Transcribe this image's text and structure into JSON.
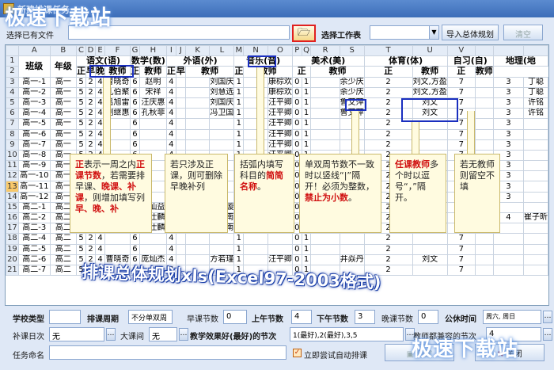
{
  "window": {
    "title": "新建排课任务"
  },
  "watermark": {
    "text": "极速下载站"
  },
  "top": {
    "task_name_label": "选择已有文件",
    "task_name_value": "",
    "workbook_label": "选择工作表",
    "workbook_value": "",
    "import_button": "导入总体规划",
    "clear_button": "清空"
  },
  "sheet": {
    "col_letters": [
      "A",
      "B",
      "C",
      "D",
      "E",
      "F",
      "G",
      "H",
      "I",
      "J",
      "K",
      "L",
      "M",
      "N",
      "O",
      "P",
      "Q",
      "R",
      "S",
      "T",
      "U",
      "V"
    ],
    "row1": [
      "班级",
      "年级",
      "语文(语)",
      "数学(数)",
      "外语(外)",
      "音乐(音)",
      "美术(美)",
      "体育(体)",
      "自习(自)",
      "地理(地"
    ],
    "row2": [
      "正",
      "早",
      "晚",
      "教师",
      "正",
      "教师",
      "正",
      "早",
      "教师",
      "正",
      "教师",
      "正",
      "教师",
      "正",
      "教师",
      "正",
      "教师"
    ],
    "rows": [
      {
        "n": "3",
        "cls": "高一-1",
        "grade": "高一",
        "a": "5",
        "b": "2",
        "c": "4",
        "t1": "曹晓奇",
        "m": "6",
        "t2": "赵明",
        "e": "4",
        "t3": "刘国庆",
        "mu": "1",
        "t4": "康棕欢",
        "ar": "0",
        "ar2": "1",
        "t5": "余少庆",
        "pe": "2",
        "t6": "刘文,方盈",
        "z": "7",
        "geo": "3",
        "t7": "丁聪"
      },
      {
        "n": "4",
        "cls": "高一-2",
        "grade": "高一",
        "a": "5",
        "b": "2",
        "c": "4",
        "t1": "孔伯聚",
        "m": "6",
        "t2": "宋祥",
        "e": "4",
        "t3": "刘慧选",
        "mu": "1",
        "t4": "康棕欢",
        "ar": "0",
        "ar2": "1",
        "t5": "余少庆",
        "pe": "2",
        "t6": "刘文,方盈",
        "z": "7",
        "geo": "3",
        "t7": "丁聪"
      },
      {
        "n": "5",
        "cls": "高一-3",
        "grade": "高一",
        "a": "5",
        "b": "2",
        "c": "4",
        "t1": "吕旭雷",
        "m": "6",
        "t2": "汪庆惠",
        "e": "4",
        "t3": "刘国庆",
        "mu": "1",
        "t4": "汪平卿",
        "ar": "0",
        "ar2": "1",
        "t5": "鲁艾萍",
        "pe": "2",
        "t6": "刘文",
        "z": "7",
        "geo": "3",
        "t7": "许铭"
      },
      {
        "n": "6",
        "cls": "高一-4",
        "grade": "高一",
        "a": "5",
        "b": "2",
        "c": "4",
        "t1": "刘继惠",
        "m": "6",
        "t2": "孔秋菲",
        "e": "4",
        "t3": "冯卫国",
        "mu": "1",
        "t4": "汪平卿",
        "ar": "0",
        "ar2": "1",
        "t5": "鲁艾萍",
        "pe": "2",
        "t6": "刘文",
        "z": "7",
        "geo": "3",
        "t7": "许铭"
      },
      {
        "n": "7",
        "cls": "高一-5",
        "grade": "高一",
        "a": "5",
        "b": "2",
        "c": "4",
        "t1": "",
        "m": "6",
        "t2": "",
        "e": "4",
        "t3": "",
        "mu": "1",
        "t4": "汪平卿",
        "ar": "0",
        "ar2": "1",
        "t5": "",
        "pe": "2",
        "t6": "",
        "z": "7",
        "geo": "3",
        "t7": ""
      },
      {
        "n": "8",
        "cls": "高一-6",
        "grade": "高一",
        "a": "5",
        "b": "2",
        "c": "4",
        "t1": "",
        "m": "6",
        "t2": "",
        "e": "4",
        "t3": "",
        "mu": "1",
        "t4": "汪平卿",
        "ar": "0",
        "ar2": "1",
        "t5": "",
        "pe": "2",
        "t6": "",
        "z": "7",
        "geo": "3",
        "t7": ""
      },
      {
        "n": "9",
        "cls": "高一-7",
        "grade": "高一",
        "a": "5",
        "b": "2",
        "c": "4",
        "t1": "",
        "m": "6",
        "t2": "",
        "e": "4",
        "t3": "",
        "mu": "1",
        "t4": "汪平卿",
        "ar": "0",
        "ar2": "1",
        "t5": "",
        "pe": "2",
        "t6": "",
        "z": "7",
        "geo": "3",
        "t7": ""
      },
      {
        "n": "10",
        "cls": "高一-8",
        "grade": "高一",
        "a": "5",
        "b": "2",
        "c": "4",
        "t1": "",
        "m": "6",
        "t2": "",
        "e": "4",
        "t3": "",
        "mu": "1",
        "t4": "汪平卿",
        "ar": "0",
        "ar2": "1",
        "t5": "",
        "pe": "2",
        "t6": "",
        "z": "7",
        "geo": "3",
        "t7": ""
      },
      {
        "n": "11",
        "cls": "高一-9",
        "grade": "高一",
        "a": "5",
        "b": "2",
        "c": "4",
        "t1": "",
        "m": "6",
        "t2": "",
        "e": "4",
        "t3": "",
        "mu": "1",
        "t4": "汪平卿",
        "ar": "0",
        "ar2": "1",
        "t5": "",
        "pe": "2",
        "t6": "",
        "z": "7",
        "geo": "3",
        "t7": ""
      },
      {
        "n": "12",
        "cls": "高一-10",
        "grade": "高一",
        "a": "5",
        "b": "2",
        "c": "4",
        "t1": "",
        "m": "6",
        "t2": "",
        "e": "4",
        "t3": "",
        "mu": "1",
        "t4": "汪平卿",
        "ar": "0",
        "ar2": "1",
        "t5": "",
        "pe": "2",
        "t6": "",
        "z": "7",
        "geo": "3",
        "t7": ""
      },
      {
        "n": "13",
        "cls": "高一-11",
        "grade": "高一",
        "a": "5",
        "b": "2",
        "c": "4",
        "t1": "",
        "m": "6",
        "t2": "",
        "e": "4",
        "t3": "",
        "mu": "1",
        "t4": "汪平卿",
        "ar": "0",
        "ar2": "1",
        "t5": "",
        "pe": "2",
        "t6": "",
        "z": "7",
        "geo": "3",
        "t7": ""
      },
      {
        "n": "14",
        "cls": "高一-12",
        "grade": "高一",
        "a": "5",
        "b": "2",
        "c": "4",
        "t1": "",
        "m": "6",
        "t2": "",
        "e": "4",
        "t3": "",
        "mu": "1",
        "t4": "汪平卿",
        "ar": "0",
        "ar2": "1",
        "t5": "",
        "pe": "2",
        "t6": "",
        "z": "7",
        "geo": "3",
        "t7": ""
      },
      {
        "n": "15",
        "cls": "高二-1",
        "grade": "高二",
        "a": "5",
        "b": "2",
        "c": "4",
        "t1": "蒋景滢",
        "m": "6",
        "t2": "贾仙益",
        "e": "4",
        "t3": "康莱璇",
        "mu": "1",
        "t4": "汪平卿",
        "ar": "0",
        "ar2": "1",
        "t5": "井焱丹",
        "pe": "2",
        "t6": "刘文",
        "z": "7",
        "geo": "",
        "t7": ""
      },
      {
        "n": "16",
        "cls": "高二-2",
        "grade": "高二",
        "a": "5",
        "b": "2",
        "c": "4",
        "t1": "冉红贞",
        "m": "6",
        "t2": "邹仕麟",
        "e": "4",
        "t3": "余欧南",
        "mu": "1",
        "t4": "汪平卿",
        "ar": "0",
        "ar2": "1",
        "t5": "井焱丹",
        "pe": "2",
        "t6": "刘文",
        "z": "7",
        "geo": "4",
        "t7": "崔子昕"
      },
      {
        "n": "17",
        "cls": "高二-3",
        "grade": "高二",
        "a": "5",
        "b": "2",
        "c": "4",
        "t1": "蒋景滢",
        "m": "6",
        "t2": "邹仕麟",
        "e": "4",
        "t3": "余欧南",
        "mu": "1",
        "t4": "汪平卿",
        "ar": "0",
        "ar2": "1",
        "t5": "井焱丹",
        "pe": "2",
        "t6": "刘文",
        "z": "7",
        "geo": "",
        "t7": ""
      },
      {
        "n": "18",
        "cls": "高二-4",
        "grade": "高二",
        "a": "5",
        "b": "2",
        "c": "4",
        "t1": "",
        "m": "6",
        "t2": "",
        "e": "4",
        "t3": "",
        "mu": "1",
        "t4": "",
        "ar": "0",
        "ar2": "1",
        "t5": "",
        "pe": "2",
        "t6": "",
        "z": "7",
        "geo": "",
        "t7": ""
      },
      {
        "n": "19",
        "cls": "高二-5",
        "grade": "高二",
        "a": "5",
        "b": "2",
        "c": "4",
        "t1": "",
        "m": "6",
        "t2": "",
        "e": "4",
        "t3": "",
        "mu": "1",
        "t4": "",
        "ar": "0",
        "ar2": "1",
        "t5": "",
        "pe": "2",
        "t6": "",
        "z": "7",
        "geo": "",
        "t7": ""
      },
      {
        "n": "20",
        "cls": "高二-6",
        "grade": "高二",
        "a": "5",
        "b": "2",
        "c": "4",
        "t1": "曹晓奇",
        "m": "6",
        "t2": "庞灿杰",
        "e": "4",
        "t3": "方若瑾",
        "mu": "1",
        "t4": "汪平卿",
        "ar": "0",
        "ar2": "1",
        "t5": "井焱丹",
        "pe": "2",
        "t6": "刘文",
        "z": "7",
        "geo": "",
        "t7": ""
      },
      {
        "n": "21",
        "cls": "高二-7",
        "grade": "高二",
        "a": "5",
        "b": "2",
        "c": "4",
        "t1": "",
        "m": "6",
        "t2": "",
        "e": "4",
        "t3": "",
        "mu": "1",
        "t4": "",
        "ar": "0",
        "ar2": "1",
        "t5": "",
        "pe": "2",
        "t6": "",
        "z": "7",
        "geo": "",
        "t7": ""
      }
    ]
  },
  "notes": {
    "n1": [
      "正",
      "表示一周之内",
      "正课节数",
      "，若需要排早课、",
      "晚课、补课",
      "，则增加填写列",
      "早、晚、补"
    ],
    "n2": "若只涉及正课，则可删除早晚补列",
    "n3": [
      "括弧内填写",
      "科目的",
      "简简名称",
      "。"
    ],
    "n4": [
      "单双周节数不一致时以竖线“|”隔开！必须为整数，",
      "禁止为小数",
      "。"
    ],
    "n5": [
      "任课教师",
      "多个时以逗号“，”隔开。"
    ],
    "n6": "若无教师则留空不填"
  },
  "banner": {
    "text": "排课总体规划xls(Excel97-2003格式)"
  },
  "bottom": {
    "school_type_label": "学校类型",
    "school_type_value": "",
    "period_label": "排课周期",
    "period_value": "不分单双周",
    "morning_label": "早课节数",
    "morning_value": "0",
    "am_label": "上午节数",
    "am_value": "4",
    "pm_label": "下午节数",
    "pm_value": "3",
    "evening_label": "晚课节数",
    "evening_value": "0",
    "public_label": "公休时间",
    "public_value": "周六, 周日",
    "makeup_label": "补课日次",
    "makeup_value": "无",
    "bigbreak_label": "大课间",
    "bigbreak_value": "无",
    "best_label": "教学效果好(最好)的节次",
    "best_value": "1(最好),2(最好),3,5",
    "teacher_hint_label": "教师都兼容的节次",
    "teacher_hint_value": "4",
    "task_label": "任务命名",
    "task_value": "",
    "auto_label": "立即尝试自动排课",
    "create_button": "创建",
    "close_button": "关闭"
  }
}
